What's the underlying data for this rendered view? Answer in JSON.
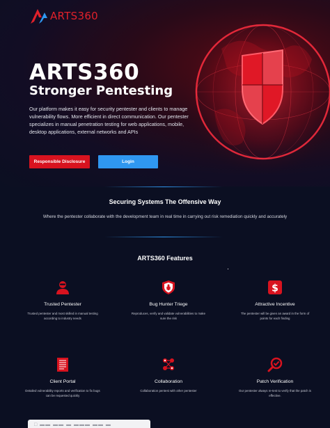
{
  "header": {
    "logo_text": "ARTS360"
  },
  "hero": {
    "title": "ARTS360",
    "subtitle": "Stronger Pentesting",
    "description": "Our platform makes it easy for security pentester and clients to manage vulnerability flows. More efficient in direct communication. Our pentester specializes in manual penetration testing for web applications, mobile, desktop applications, external networks and APIs",
    "primary_button": "Responsible Disclosure",
    "secondary_button": "Login"
  },
  "offensive": {
    "title": "Securing Systems The Offensive Way",
    "text": "Where the pentester collaborate with the development team in real time in carrying out risk remediation quickly and accurately"
  },
  "features": {
    "title": "ARTS360 Features",
    "items": [
      {
        "icon": "hacker-icon",
        "name": "Trusted Pentester",
        "desc": "Trusted pentester and most skilled in manual testing according to industry needs"
      },
      {
        "icon": "shield-bug-icon",
        "name": "Bug Hunter Triege",
        "desc": "Reproduces, verify and validate vulnerabilities to make sure the risk"
      },
      {
        "icon": "dollar-icon",
        "name": "Attractive Incentive",
        "desc": "The pentester will be given an award in the form of points for each finding"
      },
      {
        "icon": "document-icon",
        "name": "Client Portal",
        "desc": "Detailed vulnerability reports and verification to fix bugs can be requested quickly"
      },
      {
        "icon": "collaboration-icon",
        "name": "Collaboration",
        "desc": "Collaboration pentest with other pentester"
      },
      {
        "icon": "patch-verification-icon",
        "name": "Patch Verification",
        "desc": "Our pentester always re-test to verify that the patch is effective."
      }
    ]
  },
  "colors": {
    "accent_red": "#d8131f",
    "accent_blue": "#2f97f0",
    "background": "#0b0f22"
  }
}
